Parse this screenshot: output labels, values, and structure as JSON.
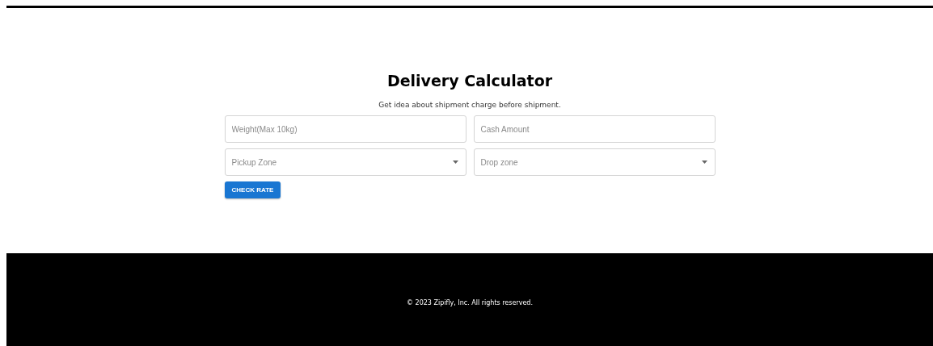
{
  "title": "Delivery Calculator",
  "subtitle": "Get idea about shipment charge before shipment.",
  "fields": [
    {
      "kind": "input",
      "placeholder": "Weight(Max 10kg)"
    },
    {
      "kind": "input",
      "placeholder": "Cash Amount"
    },
    {
      "kind": "select",
      "placeholder": "Pickup Zone"
    },
    {
      "kind": "select",
      "placeholder": "Drop zone"
    }
  ],
  "button": "CHECK RATE",
  "footer": "© 2023 Zipifly, Inc. All rights reserved."
}
